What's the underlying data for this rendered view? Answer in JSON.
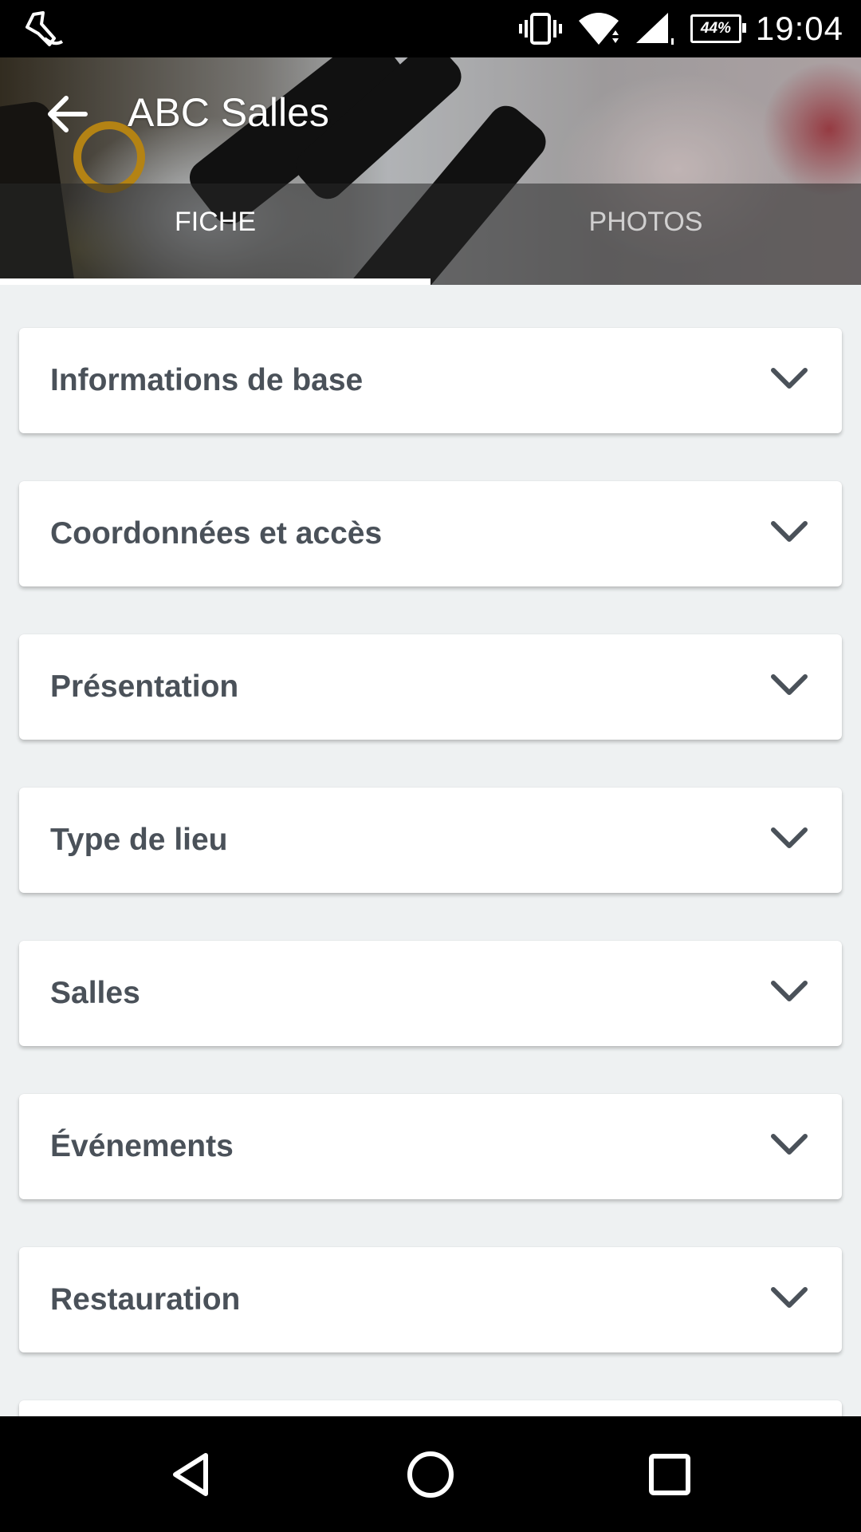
{
  "status_bar": {
    "time": "19:04",
    "battery": "44%",
    "icons": [
      "notification-app-icon",
      "vibrate-icon",
      "wifi-icon",
      "signal-icon",
      "battery-icon"
    ]
  },
  "header": {
    "title": "ABC Salles",
    "back_icon": "arrow-left-icon",
    "tabs": [
      {
        "label": "FICHE",
        "active": true
      },
      {
        "label": "PHOTOS",
        "active": false
      }
    ]
  },
  "sections": [
    {
      "label": "Informations de base"
    },
    {
      "label": "Coordonnées et accès"
    },
    {
      "label": "Présentation"
    },
    {
      "label": "Type de lieu"
    },
    {
      "label": "Salles"
    },
    {
      "label": "Événements"
    },
    {
      "label": "Restauration"
    }
  ],
  "nav_bar": {
    "icons": [
      "back-triangle-icon",
      "home-circle-icon",
      "recents-square-icon"
    ]
  },
  "colors": {
    "background": "#eef1f2",
    "card_text": "#4a5159",
    "tab_indicator": "#ffffff"
  }
}
